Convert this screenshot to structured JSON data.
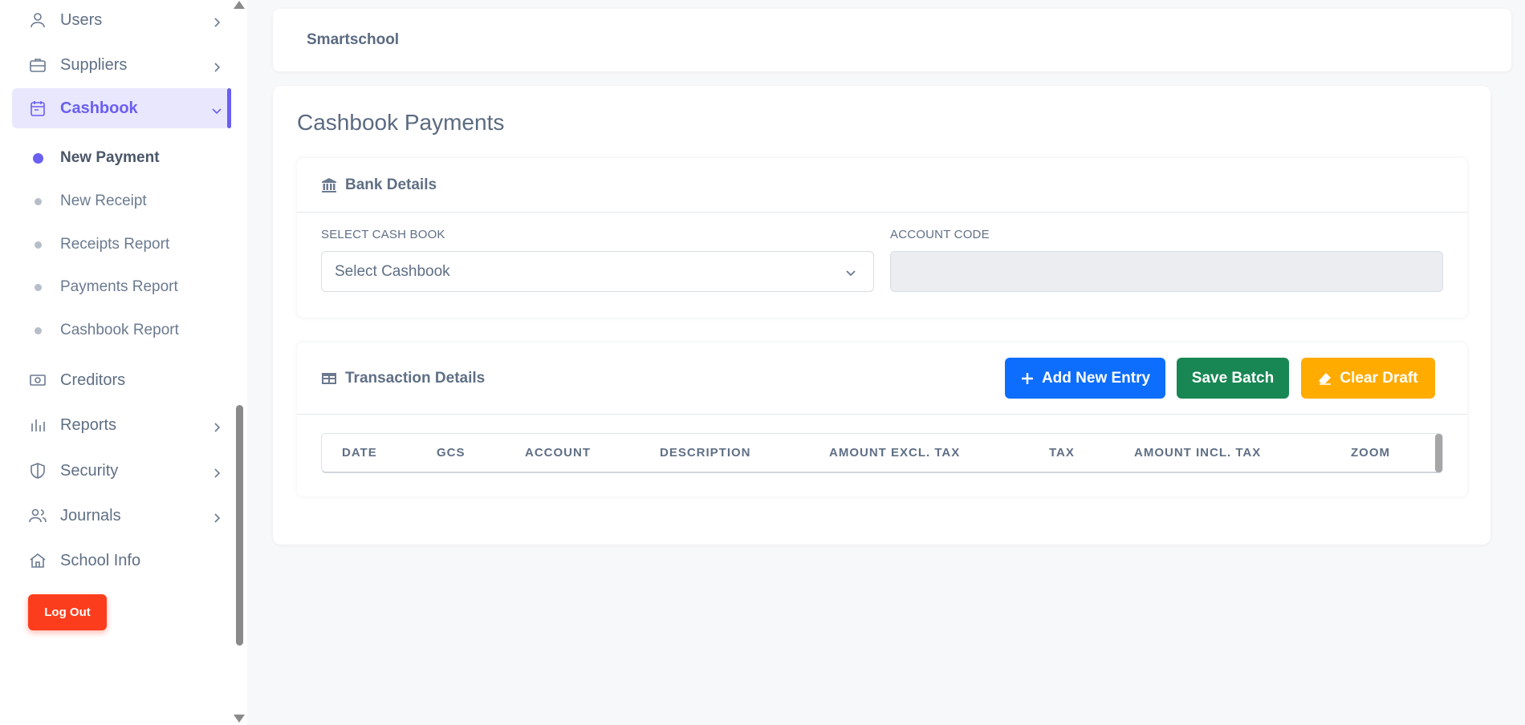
{
  "sidebar": {
    "items": [
      {
        "label": "Users",
        "icon": "user-icon",
        "has_chevron": true
      },
      {
        "label": "Suppliers",
        "icon": "briefcase-icon",
        "has_chevron": true
      },
      {
        "label": "Cashbook",
        "icon": "calendar-icon",
        "has_chevron": true,
        "active": true
      },
      {
        "label": "Creditors",
        "icon": "cash-icon",
        "has_chevron": false
      },
      {
        "label": "Reports",
        "icon": "bar-chart-icon",
        "has_chevron": true
      },
      {
        "label": "Security",
        "icon": "shield-icon",
        "has_chevron": true
      },
      {
        "label": "Journals",
        "icon": "users-icon",
        "has_chevron": true
      },
      {
        "label": "School Info",
        "icon": "home-icon",
        "has_chevron": false
      }
    ],
    "cashbook_subitems": [
      {
        "label": "New Payment",
        "current": true
      },
      {
        "label": "New Receipt"
      },
      {
        "label": "Receipts Report"
      },
      {
        "label": "Payments Report"
      },
      {
        "label": "Cashbook Report"
      }
    ],
    "logout_label": "Log Out"
  },
  "header": {
    "brand": "Smartschool"
  },
  "main": {
    "title": "Cashbook Payments",
    "bank_details": {
      "title": "Bank Details",
      "icon": "bank-icon",
      "select_label": "SELECT CASH BOOK",
      "select_value": "Select Cashbook",
      "account_label": "ACCOUNT CODE",
      "account_value": ""
    },
    "transactions": {
      "title": "Transaction Details",
      "icon": "table-icon",
      "add_label": "Add New Entry",
      "save_label": "Save Batch",
      "clear_label": "Clear Draft",
      "columns": [
        "DATE",
        "GCS",
        "ACCOUNT",
        "DESCRIPTION",
        "AMOUNT EXCL. TAX",
        "TAX",
        "AMOUNT INCL. TAX",
        "ZOOM"
      ]
    }
  },
  "colors": {
    "accent": "#6a5ff0",
    "primary": "#0d6efd",
    "success": "#198754",
    "warning": "#ffab00",
    "danger": "#fb3d1d"
  }
}
